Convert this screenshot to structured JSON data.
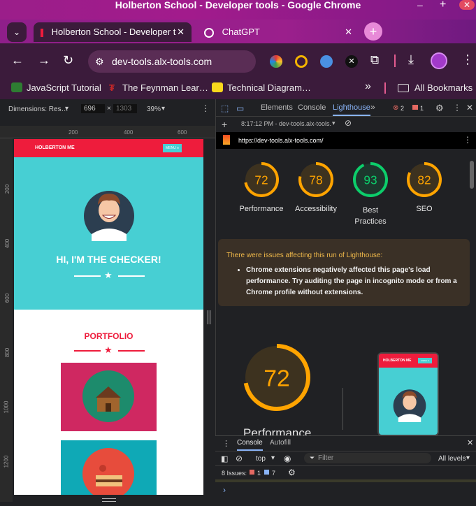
{
  "window": {
    "title": "Holberton School - Developer tools - Google Chrome"
  },
  "tabs": [
    {
      "label": "Holberton School - Developer t"
    },
    {
      "label": "ChatGPT"
    }
  ],
  "omnibox": {
    "url": "dev-tools.alx-tools.com"
  },
  "bookmarks": {
    "items": [
      "JavaScript Tutorial",
      "The Feynman Lear…",
      "Technical Diagram…"
    ],
    "all_label": "All Bookmarks",
    "overflow": "»"
  },
  "device_toolbar": {
    "dimensions_label": "Dimensions: Res…",
    "width_value": "696",
    "height_value": "1303",
    "zoom": "39%",
    "ruler_ticks": [
      "200",
      "400",
      "600"
    ],
    "vruler_ticks": [
      "200",
      "400",
      "600",
      "800",
      "1000",
      "1200"
    ]
  },
  "site": {
    "brand": "HOLBERTON ME",
    "menu_label": "MENU ≡",
    "hero_heading": "HI, I'M THE CHECKER!",
    "portfolio_heading": "PORTFOLIO"
  },
  "devtools": {
    "panel_tabs": [
      "Elements",
      "Console",
      "Lighthouse"
    ],
    "errors_count": "2",
    "warnings_count": "1",
    "report_label": "8:17:12 PM - dev-tools.alx-tools.",
    "report_url": "https://dev-tools.alx-tools.com/"
  },
  "lighthouse": {
    "scores": [
      {
        "label": "Performance",
        "value": 72,
        "color": "#ffa400"
      },
      {
        "label": "Accessibility",
        "value": 78,
        "color": "#ffa400"
      },
      {
        "label": "Best Practices",
        "value": 93,
        "color": "#0cce6b"
      },
      {
        "label": "SEO",
        "value": 82,
        "color": "#ffa400"
      }
    ],
    "warning_title": "There were issues affecting this run of Lighthouse:",
    "warning_item": "Chrome extensions negatively affected this page's load performance. Try auditing the page in incognito mode or from a Chrome profile without extensions.",
    "big_score": 72,
    "big_label": "Performance",
    "thumb_brand": "HOLBERTON ME",
    "thumb_menu": "MENU ≡"
  },
  "console": {
    "tabs": [
      "Console",
      "Autofill"
    ],
    "context": "top",
    "filter_placeholder": "Filter",
    "levels": "All levels",
    "issues_label": "8 Issues:",
    "issues_errors": "1",
    "issues_info": "7",
    "prompt": "›"
  },
  "colors": {
    "brand_red": "#ee1c3c",
    "hero_teal": "#47cfd3",
    "portfolio_card_1": "#cf2861",
    "portfolio_card_2": "#0fa9b6"
  }
}
